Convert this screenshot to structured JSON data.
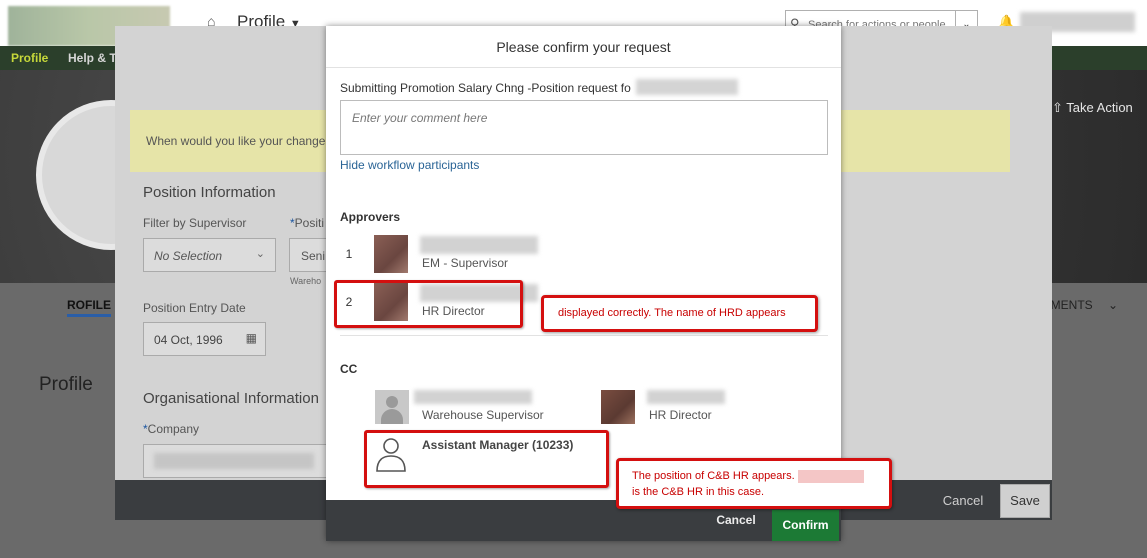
{
  "topbar": {
    "nav_title": "Profile",
    "search_placeholder": "Search for actions or people"
  },
  "greenbar": {
    "items": [
      "Profile",
      "Help & Tu"
    ]
  },
  "profile_header": {
    "take_action": "Take Action"
  },
  "profile_tabs": {
    "tab_profile": "ROFILE",
    "tab_documents": "UMENTS"
  },
  "profile_heading": "Profile",
  "form": {
    "banner_text": "When would you like your change",
    "position_info_heading": "Position Information",
    "filter_label": "Filter by Supervisor",
    "filter_value": "No Selection",
    "position_label_req": "*",
    "position_label": "Positi",
    "position_value": "Seni",
    "position_sub": "Wareho",
    "entry_date_label": "Position Entry Date",
    "entry_date_value": "04 Oct, 1996",
    "org_heading": "Organisational Information",
    "company_label_req": "*",
    "company_label": "Company",
    "cancel": "Cancel",
    "save": "Save"
  },
  "dialog": {
    "title": "Please confirm your request",
    "intro": "Submitting Promotion Salary Chng -Position request fo",
    "comment_placeholder": "Enter your comment here",
    "hide_link": "Hide workflow participants",
    "approvers_heading": "Approvers",
    "approvers": [
      {
        "num": "1",
        "role": "EM - Supervisor"
      },
      {
        "num": "2",
        "role": "HR Director"
      }
    ],
    "cc_heading": "CC",
    "cc": [
      {
        "role": "Warehouse Supervisor"
      },
      {
        "role": "HR Director"
      },
      {
        "role": "Assistant Manager (10233)"
      }
    ],
    "cancel": "Cancel",
    "confirm": "Confirm"
  },
  "annotations": {
    "note1": "displayed correctly. The name of HRD appears",
    "note2_line1": "The position of C&B HR appears.",
    "note2_line2": "is the C&B HR in this case."
  },
  "colors": {
    "confirm_green": "#1c7a35",
    "annotation_red": "#d40f0f",
    "link_blue": "#2a6496",
    "greenbar": "#2b3f2b"
  }
}
